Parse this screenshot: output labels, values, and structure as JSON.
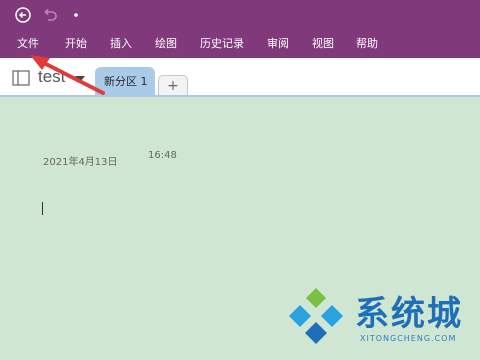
{
  "titlebar": {
    "back_icon": "back-circle-icon",
    "undo_icon": "undo-icon",
    "quick_access_icon": "dropdown-dot-icon"
  },
  "ribbon": {
    "menu": [
      "文件",
      "开始",
      "插入",
      "绘图",
      "历史记录",
      "审阅",
      "视图",
      "帮助"
    ]
  },
  "notebook": {
    "name": "test",
    "sections": [
      {
        "label": "新分区 1",
        "active": true
      }
    ],
    "add_tab_label": "+"
  },
  "page": {
    "date": "2021年4月13日",
    "time": "16:48"
  },
  "watermark": {
    "text": "系统城",
    "subtext": "XITONGCHENG.COM"
  },
  "colors": {
    "titlebar": "#80397b",
    "page_bg": "#cfe7d2",
    "active_tab": "#a9cbe9",
    "arrow": "#e23a3a",
    "watermark": "#1f6fb8"
  }
}
